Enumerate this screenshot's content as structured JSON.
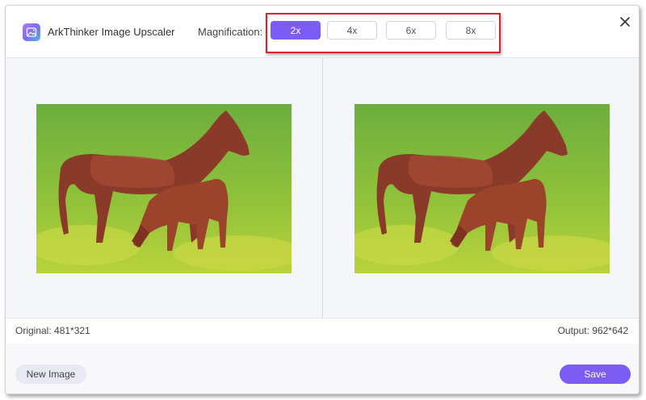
{
  "app": {
    "title": "ArkThinker Image Upscaler",
    "logo_icon": "image-upscaler-logo-icon"
  },
  "magnification": {
    "label": "Magnification:",
    "options": [
      {
        "label": "2x",
        "selected": true
      },
      {
        "label": "4x",
        "selected": false
      },
      {
        "label": "6x",
        "selected": false
      },
      {
        "label": "8x",
        "selected": false
      }
    ],
    "highlight_color": "#d9232d"
  },
  "close_icon": "close-icon",
  "preview": {
    "original_image": "mare-and-foal-on-grass-photo",
    "output_image": "mare-and-foal-on-grass-upscaled-photo"
  },
  "info": {
    "original_label": "Original: 481*321",
    "output_label": "Output: 962*642"
  },
  "footer": {
    "new_image_label": "New Image",
    "save_label": "Save"
  },
  "colors": {
    "accent": "#7b5cf5",
    "preview_bg": "#f5f6fa"
  }
}
